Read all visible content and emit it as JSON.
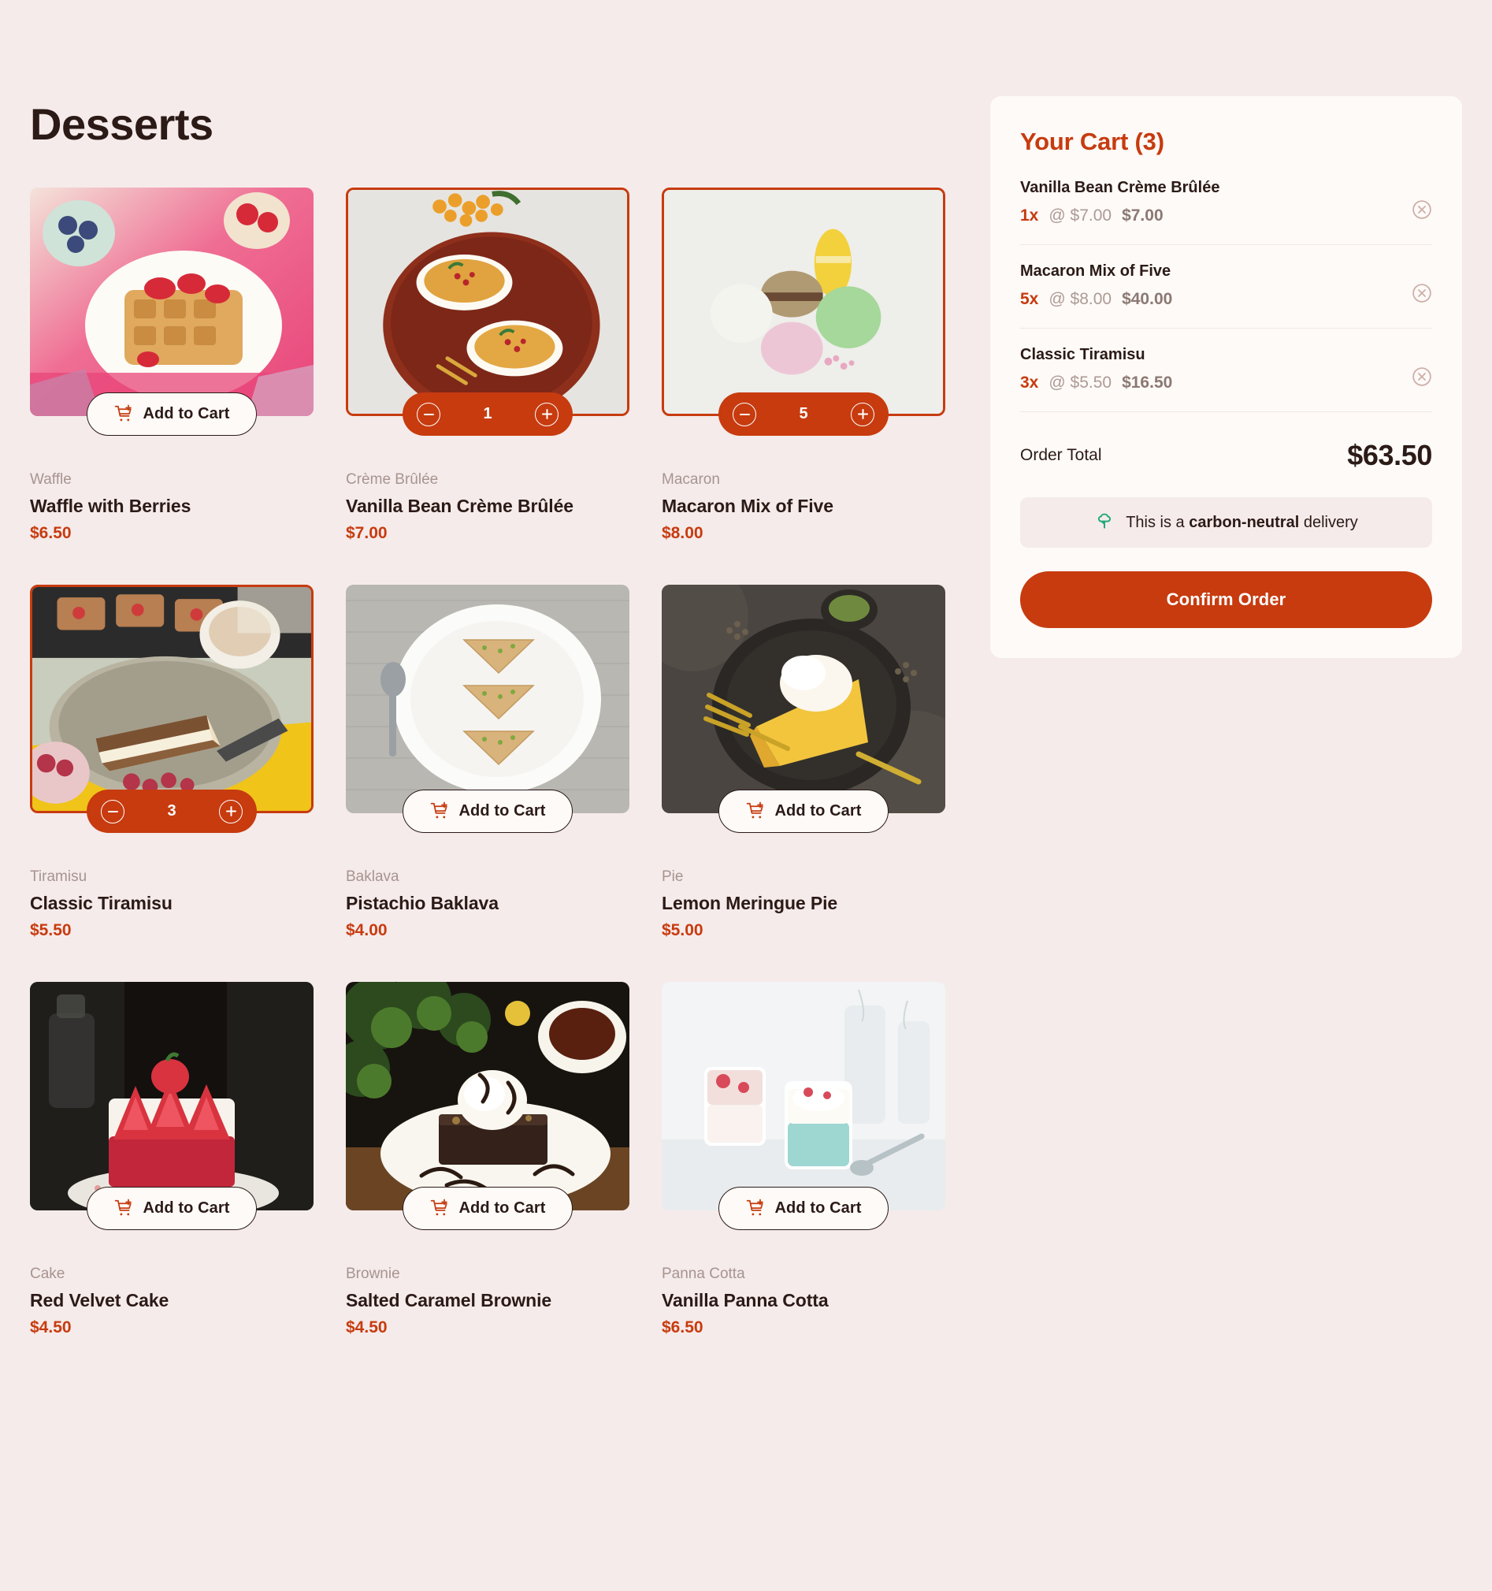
{
  "page": {
    "title": "Desserts",
    "background_color": "#F5EBEA",
    "accent_color": "#C73B0F"
  },
  "labels": {
    "add_to_cart": "Add to Cart",
    "decrement_icon": "minus-circle-icon",
    "increment_icon": "plus-circle-icon",
    "cart_icon": "add-to-cart-icon",
    "remove_icon": "remove-item-icon",
    "tree_icon": "tree-icon"
  },
  "products": [
    {
      "category": "Waffle",
      "name": "Waffle with Berries",
      "price": "$6.50",
      "selected": false,
      "quantity": 0,
      "image_alt": "waffle-with-berries-image"
    },
    {
      "category": "Crème Brûlée",
      "name": "Vanilla Bean Crème Brûlée",
      "price": "$7.00",
      "selected": true,
      "quantity": 1,
      "image_alt": "vanilla-bean-creme-brulee-image"
    },
    {
      "category": "Macaron",
      "name": "Macaron Mix of Five",
      "price": "$8.00",
      "selected": true,
      "quantity": 5,
      "image_alt": "macaron-mix-of-five-image"
    },
    {
      "category": "Tiramisu",
      "name": "Classic Tiramisu",
      "price": "$5.50",
      "selected": true,
      "quantity": 3,
      "image_alt": "classic-tiramisu-image"
    },
    {
      "category": "Baklava",
      "name": "Pistachio Baklava",
      "price": "$4.00",
      "selected": false,
      "quantity": 0,
      "image_alt": "pistachio-baklava-image"
    },
    {
      "category": "Pie",
      "name": "Lemon Meringue Pie",
      "price": "$5.00",
      "selected": false,
      "quantity": 0,
      "image_alt": "lemon-meringue-pie-image"
    },
    {
      "category": "Cake",
      "name": "Red Velvet Cake",
      "price": "$4.50",
      "selected": false,
      "quantity": 0,
      "image_alt": "red-velvet-cake-image"
    },
    {
      "category": "Brownie",
      "name": "Salted Caramel Brownie",
      "price": "$4.50",
      "selected": false,
      "quantity": 0,
      "image_alt": "salted-caramel-brownie-image"
    },
    {
      "category": "Panna Cotta",
      "name": "Vanilla Panna Cotta",
      "price": "$6.50",
      "selected": false,
      "quantity": 0,
      "image_alt": "vanilla-panna-cotta-image"
    }
  ],
  "cart": {
    "title": "Your Cart (3)",
    "items": [
      {
        "name": "Vanilla Bean Crème Brûlée",
        "qty": "1x",
        "unit_price": "@ $7.00",
        "line_total": "$7.00"
      },
      {
        "name": "Macaron Mix of Five",
        "qty": "5x",
        "unit_price": "@ $8.00",
        "line_total": "$40.00"
      },
      {
        "name": "Classic Tiramisu",
        "qty": "3x",
        "unit_price": "@ $5.50",
        "line_total": "$16.50"
      }
    ],
    "order_total_label": "Order Total",
    "order_total_value": "$63.50",
    "carbon_prefix": "This is a ",
    "carbon_bold": "carbon-neutral",
    "carbon_suffix": " delivery",
    "confirm_label": "Confirm Order"
  }
}
